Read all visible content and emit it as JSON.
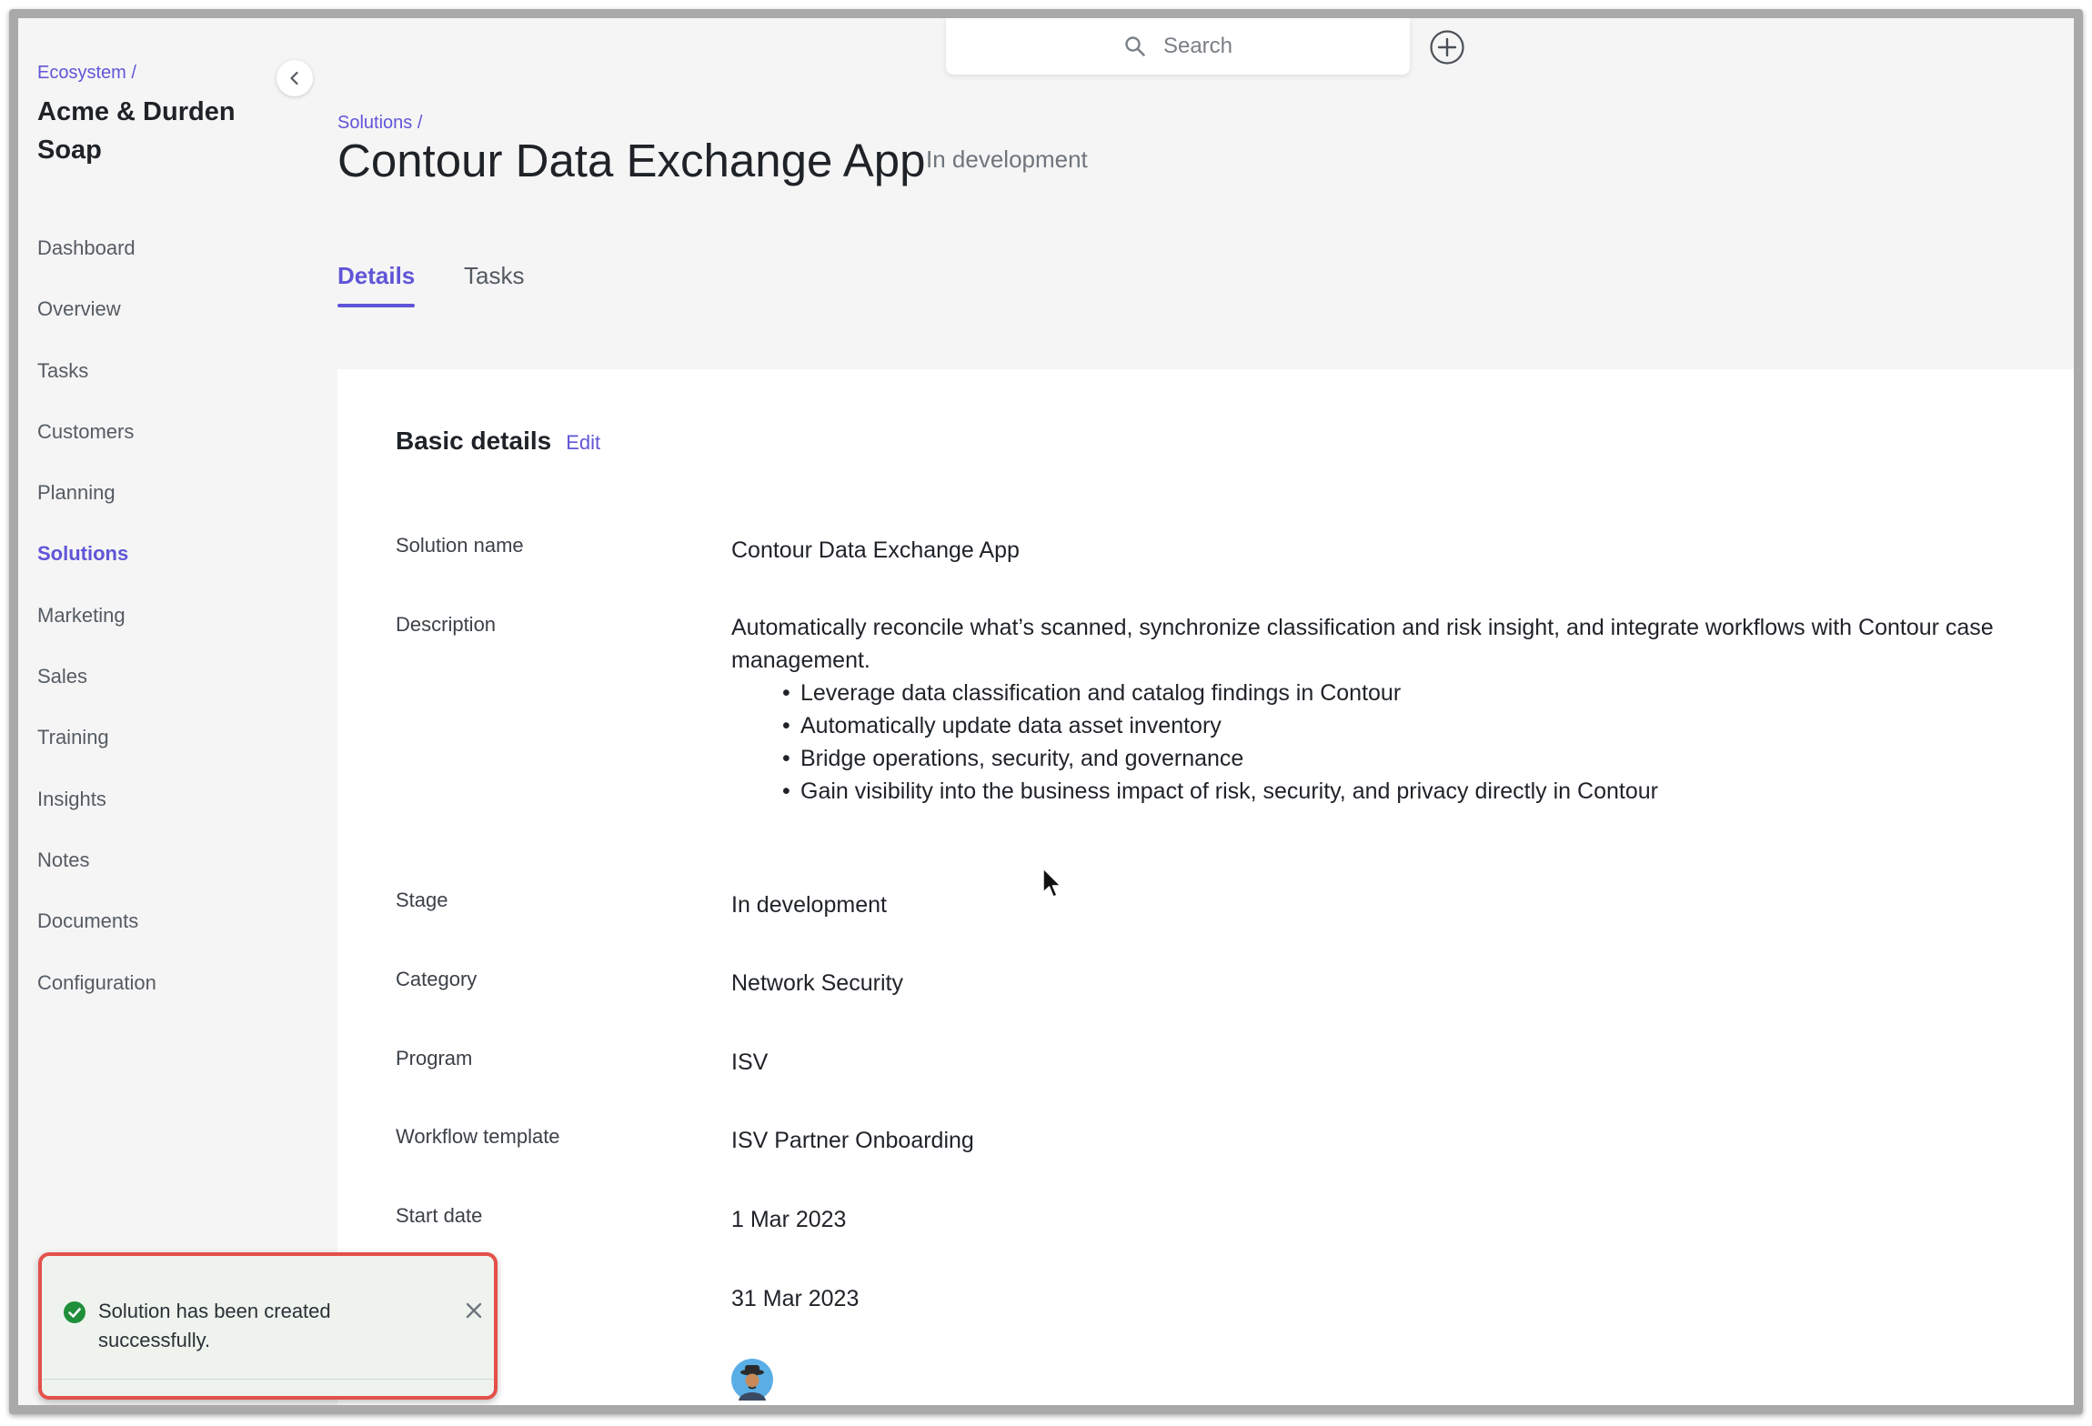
{
  "sidebar": {
    "breadcrumb": "Ecosystem /",
    "org_name": "Acme & Durden Soap",
    "items": [
      {
        "label": "Dashboard",
        "active": false
      },
      {
        "label": "Overview",
        "active": false
      },
      {
        "label": "Tasks",
        "active": false
      },
      {
        "label": "Customers",
        "active": false
      },
      {
        "label": "Planning",
        "active": false
      },
      {
        "label": "Solutions",
        "active": true
      },
      {
        "label": "Marketing",
        "active": false
      },
      {
        "label": "Sales",
        "active": false
      },
      {
        "label": "Training",
        "active": false
      },
      {
        "label": "Insights",
        "active": false
      },
      {
        "label": "Notes",
        "active": false
      },
      {
        "label": "Documents",
        "active": false
      },
      {
        "label": "Configuration",
        "active": false
      }
    ]
  },
  "header": {
    "search_placeholder": "Search",
    "breadcrumb": "Solutions /",
    "title": "Contour Data Exchange App",
    "stage": "In development"
  },
  "tabs": [
    {
      "label": "Details",
      "active": true
    },
    {
      "label": "Tasks",
      "active": false
    }
  ],
  "basic_details": {
    "title": "Basic details",
    "edit_label": "Edit",
    "fields": {
      "solution_name": {
        "label": "Solution name",
        "value": "Contour Data Exchange App"
      },
      "description": {
        "label": "Description",
        "value": "Automatically reconcile what’s scanned, synchronize classification and risk insight, and integrate workflows with Contour case management.",
        "bullets": [
          "Leverage data classification and catalog findings in Contour",
          "Automatically update data asset inventory",
          "Bridge operations, security, and governance",
          "Gain visibility into the business impact of risk, security, and privacy directly in Contour"
        ]
      },
      "stage": {
        "label": "Stage",
        "value": "In development"
      },
      "category": {
        "label": "Category",
        "value": "Network Security"
      },
      "program": {
        "label": "Program",
        "value": "ISV"
      },
      "workflow_template": {
        "label": "Workflow template",
        "value": "ISV Partner Onboarding"
      },
      "start_date": {
        "label": "Start date",
        "value": "1 Mar 2023"
      },
      "end_date": {
        "value": "31 Mar 2023"
      }
    }
  },
  "toast": {
    "message": "Solution has been created successfully.",
    "status": "success"
  },
  "colors": {
    "accent": "#6055d8",
    "success": "#1f8f3a",
    "toast_highlight": "#e4504a"
  }
}
